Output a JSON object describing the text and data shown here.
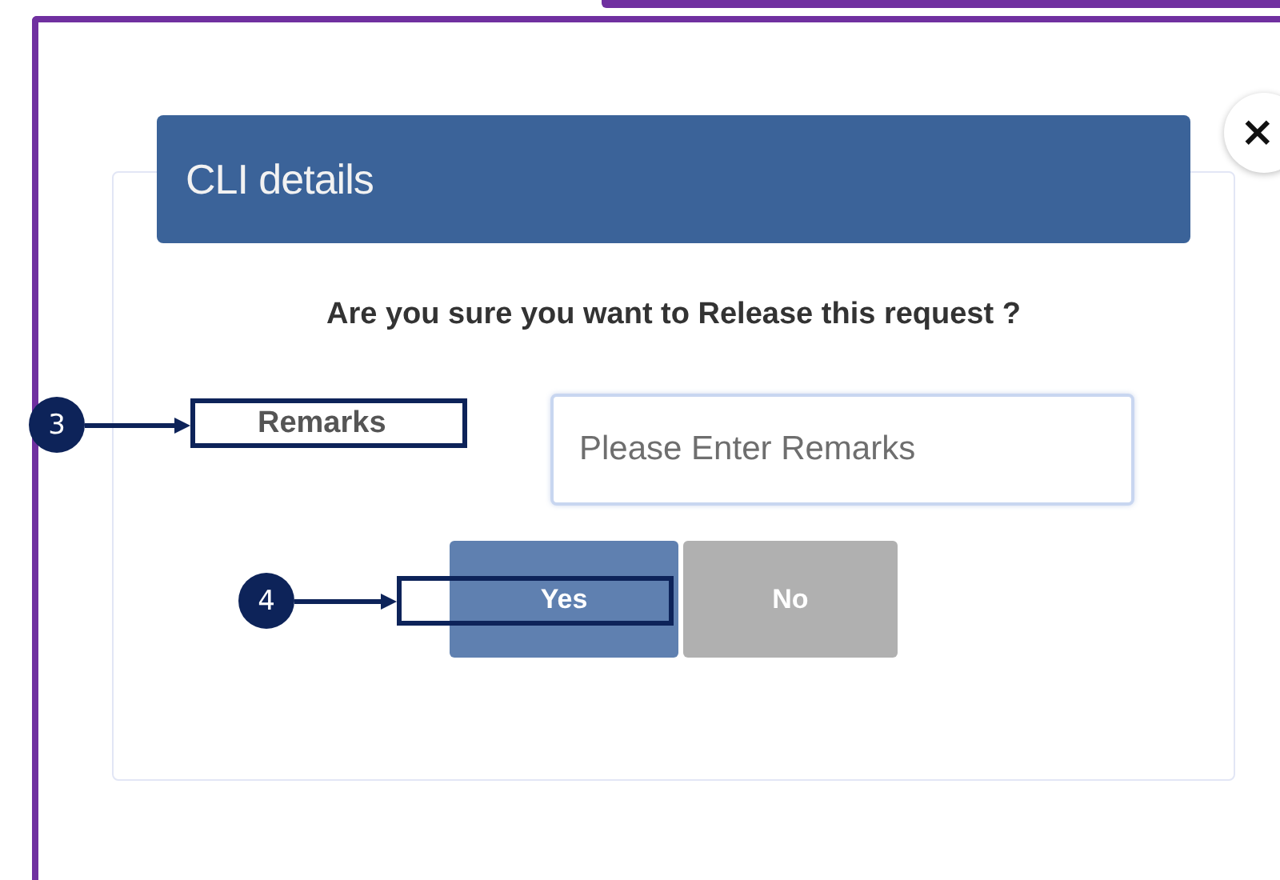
{
  "dialog": {
    "title": "CLI details",
    "close": "×",
    "question": "Are you sure you want to Release this request ?",
    "remarks": {
      "label": "Remarks",
      "callout": "3",
      "placeholder": "Please Enter Remarks"
    },
    "buttons": [
      {
        "label": "Yes",
        "kind": "primary",
        "callout": "4"
      },
      {
        "label": "No",
        "kind": "secondary"
      }
    ]
  }
}
